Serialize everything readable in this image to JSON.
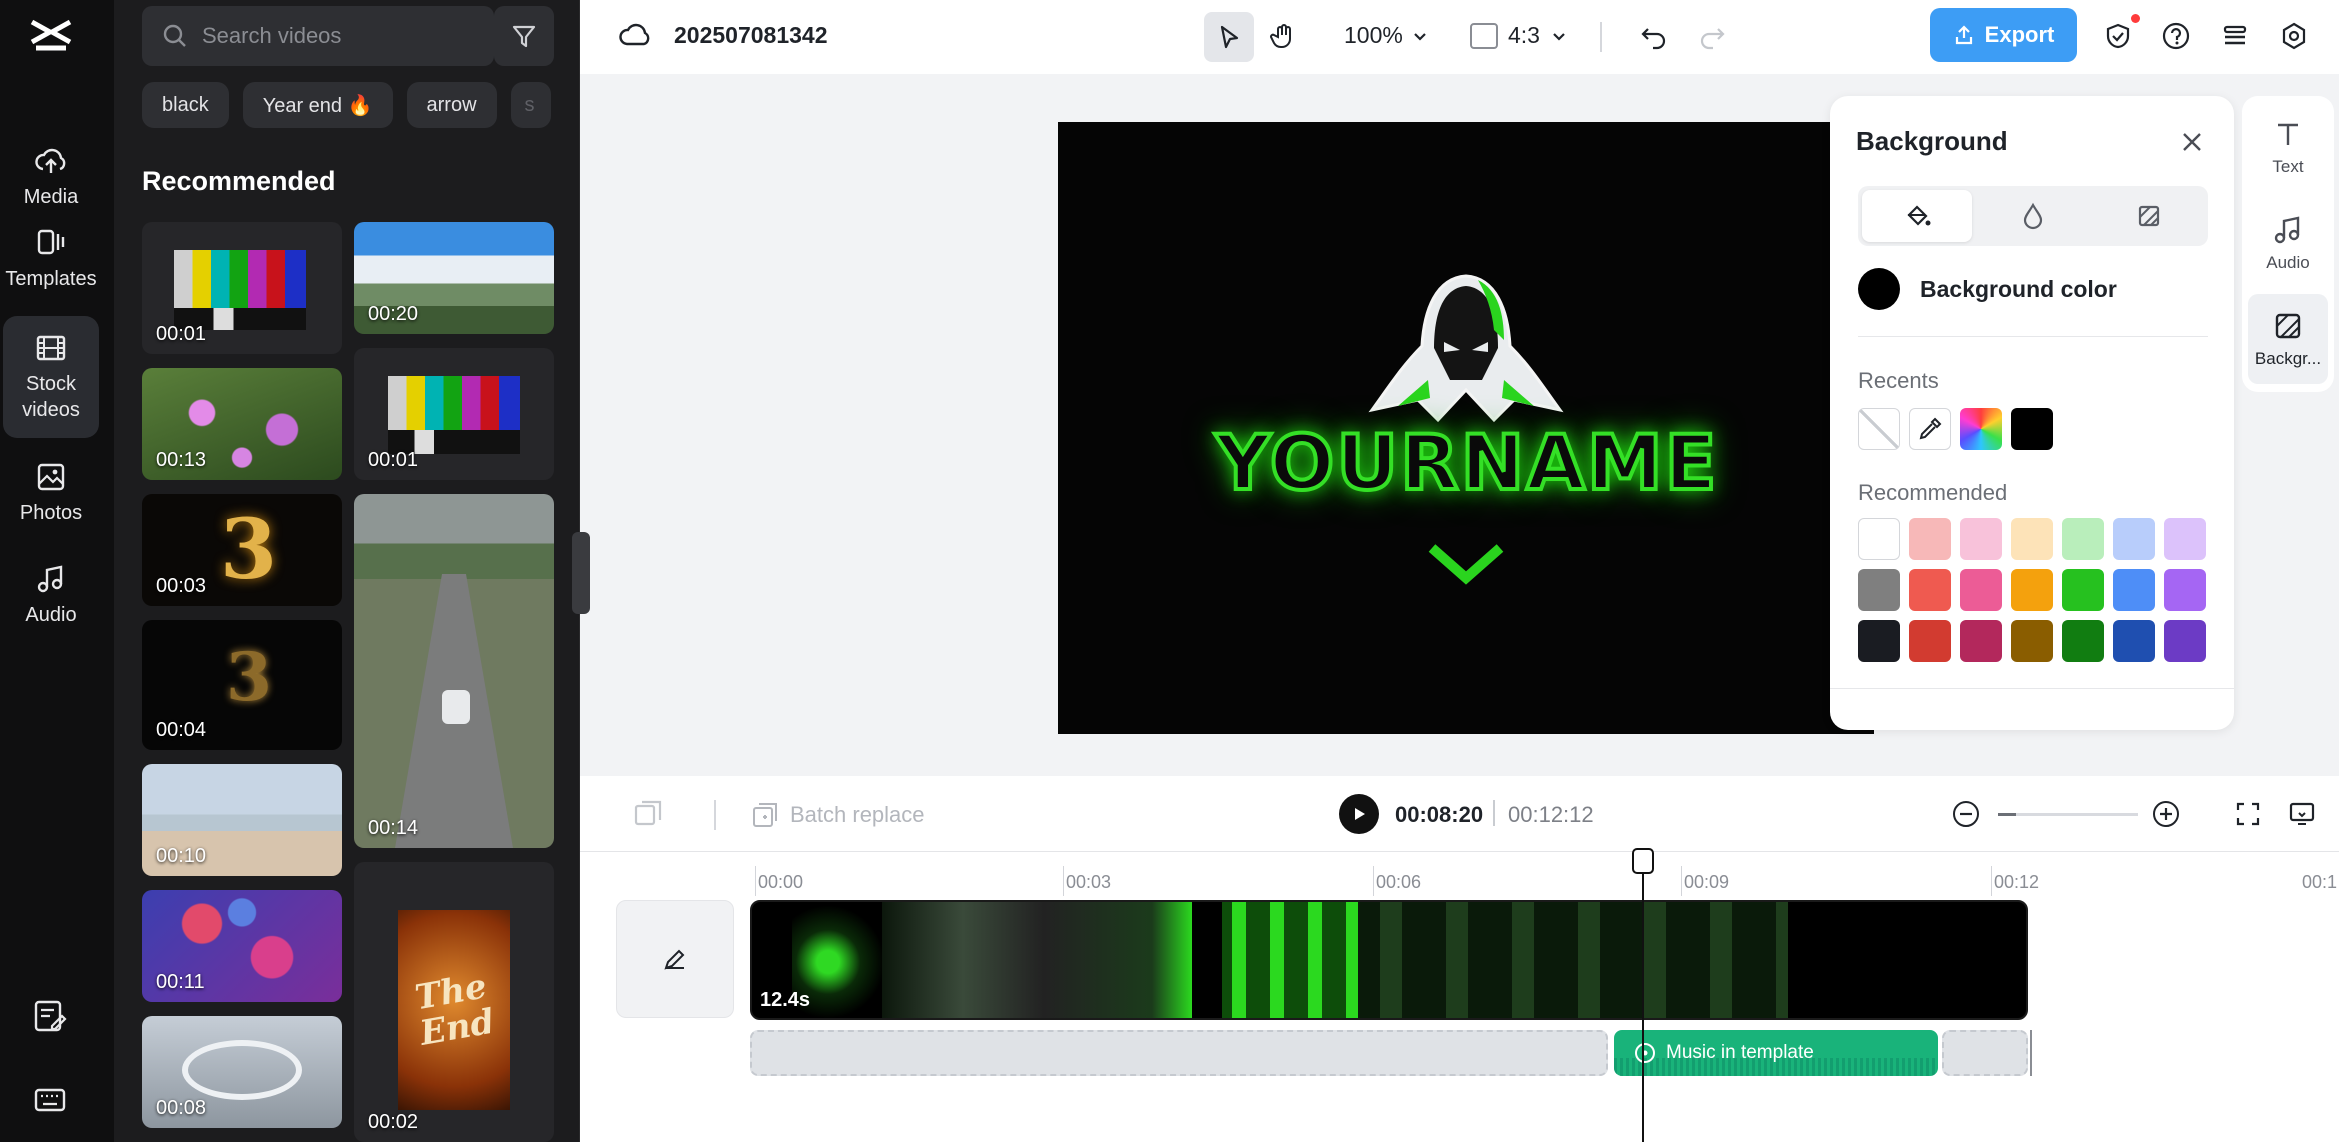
{
  "nav": {
    "items": [
      {
        "label": "Media",
        "icon": "cloud-upload-icon"
      },
      {
        "label": "Templates",
        "icon": "templates-icon"
      },
      {
        "label": "Stock videos",
        "icon": "film-icon"
      },
      {
        "label": "Photos",
        "icon": "photo-icon"
      },
      {
        "label": "Audio",
        "icon": "music-note-icon"
      }
    ],
    "active": "Stock videos"
  },
  "stock": {
    "search_placeholder": "Search videos",
    "chips": [
      "black",
      "Year end 🔥",
      "arrow",
      "s"
    ],
    "section_title": "Recommended",
    "durations": [
      "00:01",
      "00:20",
      "00:13",
      "00:01",
      "00:03",
      "00:14",
      "00:04",
      "00:10",
      "00:11",
      "00:08",
      "00:02"
    ],
    "end_card_text": "The End"
  },
  "topbar": {
    "project_title": "202507081342",
    "zoom": "100%",
    "ratio": "4:3",
    "export_label": "Export"
  },
  "canvas": {
    "headline": "YOURNAME",
    "background_color": "#000000",
    "accent_color": "#2bd91f"
  },
  "background_panel": {
    "title": "Background",
    "color_label": "Background color",
    "recents_label": "Recents",
    "recommended_label": "Recommended",
    "recent_colors": [
      "none",
      "eyedropper",
      "gradient",
      "#000000"
    ],
    "recommended_colors": [
      "#ffffff",
      "#f7b8b8",
      "#f8c2da",
      "#fde3b8",
      "#b9eebb",
      "#b8cdfb",
      "#dcc2fb",
      "#7f7f7f",
      "#ef5a50",
      "#ec5c96",
      "#f4a10d",
      "#26c11f",
      "#4e8ef7",
      "#a566f3",
      "#1a1c22",
      "#d23b30",
      "#b3285c",
      "#8a5d00",
      "#117d11",
      "#1f4fb0",
      "#6c3bc5"
    ]
  },
  "right_rail": {
    "items": [
      {
        "label": "Text",
        "icon": "text-icon"
      },
      {
        "label": "Audio",
        "icon": "music-note-icon"
      },
      {
        "label": "Backgr...",
        "icon": "background-icon"
      }
    ]
  },
  "playback": {
    "batch_label": "Batch replace",
    "current_time": "00:08:20",
    "total_time": "00:12:12"
  },
  "timeline": {
    "ticks": [
      "00:00",
      "00:03",
      "00:06",
      "00:09",
      "00:12",
      "00:1"
    ],
    "clip_length": "12.4s",
    "music_label": "Music in template"
  }
}
